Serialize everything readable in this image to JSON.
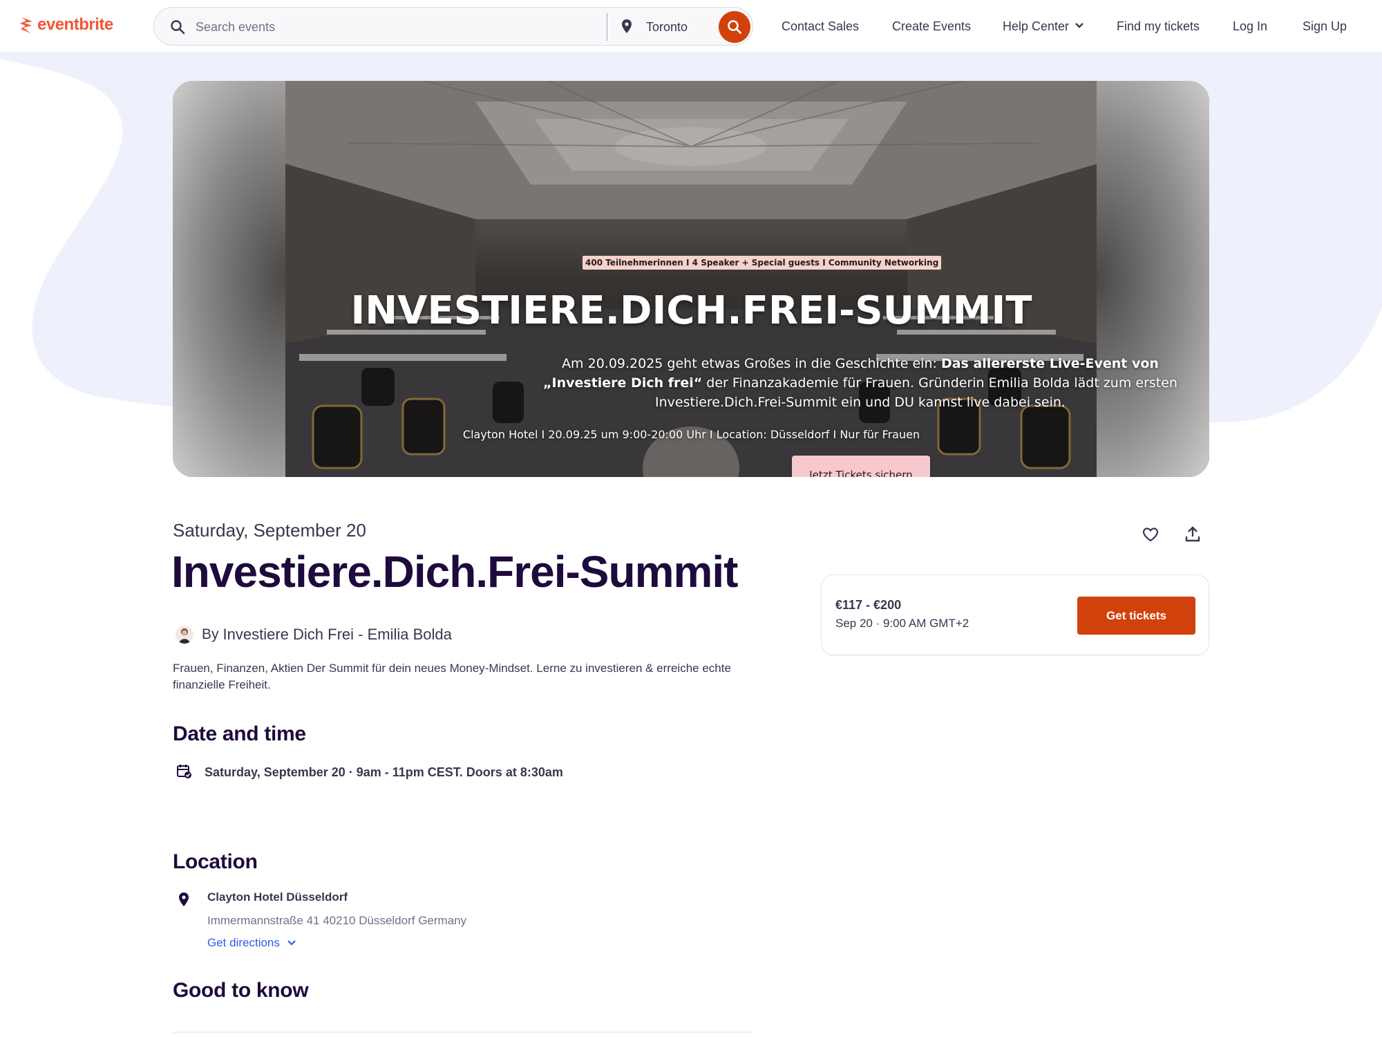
{
  "brand": {
    "name": "eventbrite",
    "accent": "#f05537",
    "cta_color": "#d1410c",
    "link_color": "#3659e3"
  },
  "search": {
    "placeholder": "Search events",
    "value": "",
    "location": "Toronto"
  },
  "nav": {
    "contact_sales": "Contact Sales",
    "create_events": "Create Events",
    "help_center": "Help Center",
    "find_tickets": "Find my tickets",
    "log_in": "Log In",
    "sign_up": "Sign Up"
  },
  "hero": {
    "tagline": "400 Teilnehmerinnen  I 4 Speaker + Special guests I Community Networking",
    "title": "INVESTIERE.DICH.FREI-SUMMIT",
    "desc_part1": "Am 20.09.2025 geht etwas Großes in die Geschichte ein:  ",
    "desc_bold": "Das allererste Live-Event von „Investiere Dich frei“",
    "desc_part2": "  der Finanzakademie für Frauen. Gründerin Emilia Bolda lädt zum ersten Investiere.Dich.Frei-Summit ein und DU kannst live dabei sein.",
    "meta": "Clayton Hotel I 20.09.25 um 9:00-20:00 Uhr I Location: Düsseldorf I Nur für Frauen",
    "cta": "Jetzt Tickets sichern"
  },
  "event": {
    "date": "Saturday, September 20",
    "title": "Investiere.Dich.Frei-Summit",
    "by_label": "By",
    "organizer": "Investiere Dich Frei - Emilia Bolda",
    "summary": "Frauen, Finanzen, Aktien Der Summit für dein neues Money-Mindset. Lerne zu investieren & erreiche echte finanzielle Freiheit."
  },
  "date_time": {
    "heading": "Date and time",
    "value": "Saturday, September 20 · 9am - 11pm CEST. Doors at 8:30am"
  },
  "location": {
    "heading": "Location",
    "venue": "Clayton Hotel Düsseldorf",
    "address": "Immermannstraße 41 40210 Düsseldorf Germany",
    "directions": "Get directions"
  },
  "good_to_know": {
    "heading": "Good to know"
  },
  "ticket": {
    "price": "€117 - €200",
    "when": "Sep 20 · 9:00 AM GMT+2",
    "button": "Get tickets"
  },
  "icons": {
    "logo": "eventbrite-logo-icon",
    "search": "search-icon",
    "location": "map-pin-icon",
    "help_chevron": "chevron-down-icon",
    "like": "heart-icon",
    "share": "share-icon",
    "calendar": "calendar-check-icon",
    "directions_chevron": "chevron-down-icon"
  }
}
